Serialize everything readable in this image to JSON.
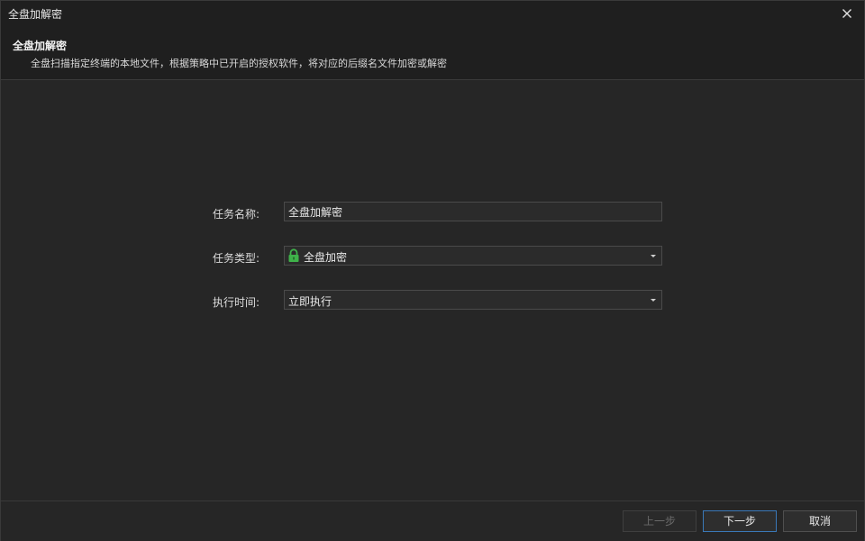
{
  "window": {
    "title": "全盘加解密",
    "close_icon": "close-icon"
  },
  "header": {
    "title": "全盘加解密",
    "description": "全盘扫描指定终端的本地文件，根据策略中已开启的授权软件，将对应的后缀名文件加密或解密"
  },
  "form": {
    "task_name": {
      "label": "任务名称:",
      "value": "全盘加解密"
    },
    "task_type": {
      "label": "任务类型:",
      "icon": "lock-icon",
      "icon_color": "#3fb24a",
      "value": "全盘加密"
    },
    "exec_time": {
      "label": "执行时间:",
      "value": "立即执行"
    }
  },
  "footer": {
    "prev_label": "上一步",
    "next_label": "下一步",
    "cancel_label": "取消"
  },
  "colors": {
    "background": "#262626",
    "header_bg": "#1f1f1f",
    "primary_border": "#3a78b8"
  }
}
